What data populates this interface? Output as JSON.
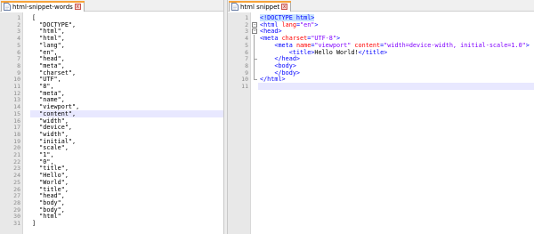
{
  "left_tab": {
    "title": "html-snippet-words",
    "close_label": "x"
  },
  "right_tab": {
    "title": "html snippet",
    "close_label": "x"
  },
  "left_lines": [
    "[",
    "  \"DOCTYPE\",",
    "  \"html\",",
    "  \"html\",",
    "  \"lang\",",
    "  \"en\",",
    "  \"head\",",
    "  \"meta\",",
    "  \"charset\",",
    "  \"UTF\",",
    "  \"8\",",
    "  \"meta\",",
    "  \"name\",",
    "  \"viewport\",",
    "  \"content\",",
    "  \"width\",",
    "  \"device\",",
    "  \"width\",",
    "  \"initial\",",
    "  \"scale\",",
    "  \"1\",",
    "  \"0\",",
    "  \"title\",",
    "  \"Hello\",",
    "  \"World\",",
    "  \"title\",",
    "  \"head\",",
    "  \"body\",",
    "  \"body\",",
    "  \"html\"",
    "]"
  ],
  "left_highlight_line": 15,
  "right_highlight_line": 11,
  "right_lines": [
    [
      {
        "c": "t-doctype",
        "t": "<!DOCTYPE html>"
      }
    ],
    [
      {
        "c": "t-tag",
        "t": "<html "
      },
      {
        "c": "t-attr",
        "t": "lang"
      },
      {
        "c": "t-tag",
        "t": "="
      },
      {
        "c": "t-val",
        "t": "\"en\""
      },
      {
        "c": "t-tag",
        "t": ">"
      }
    ],
    [
      {
        "c": "t-tag",
        "t": "<head>"
      }
    ],
    [
      {
        "c": "t-tag",
        "t": "<meta "
      },
      {
        "c": "t-attr",
        "t": "charset"
      },
      {
        "c": "t-tag",
        "t": "="
      },
      {
        "c": "t-val",
        "t": "\"UTF-8\""
      },
      {
        "c": "t-tag",
        "t": ">"
      }
    ],
    [
      {
        "c": "t-text",
        "t": "    "
      },
      {
        "c": "t-tag",
        "t": "<meta "
      },
      {
        "c": "t-attr",
        "t": "name"
      },
      {
        "c": "t-tag",
        "t": "="
      },
      {
        "c": "t-val",
        "t": "\"viewport\""
      },
      {
        "c": "t-tag",
        "t": " "
      },
      {
        "c": "t-attr",
        "t": "content"
      },
      {
        "c": "t-tag",
        "t": "="
      },
      {
        "c": "t-val",
        "t": "\"width=device-width, initial-scale=1.0\""
      },
      {
        "c": "t-tag",
        "t": ">"
      }
    ],
    [
      {
        "c": "t-text",
        "t": "        "
      },
      {
        "c": "t-tag",
        "t": "<title>"
      },
      {
        "c": "t-text",
        "t": "Hello World!"
      },
      {
        "c": "t-tag",
        "t": "</title>"
      }
    ],
    [
      {
        "c": "t-text",
        "t": "    "
      },
      {
        "c": "t-tag",
        "t": "</head>"
      }
    ],
    [
      {
        "c": "t-text",
        "t": "    "
      },
      {
        "c": "t-tag",
        "t": "<body>"
      }
    ],
    [
      {
        "c": "t-text",
        "t": "    "
      },
      {
        "c": "t-tag",
        "t": "</body>"
      }
    ],
    [
      {
        "c": "t-tag",
        "t": "</html>"
      }
    ],
    []
  ]
}
